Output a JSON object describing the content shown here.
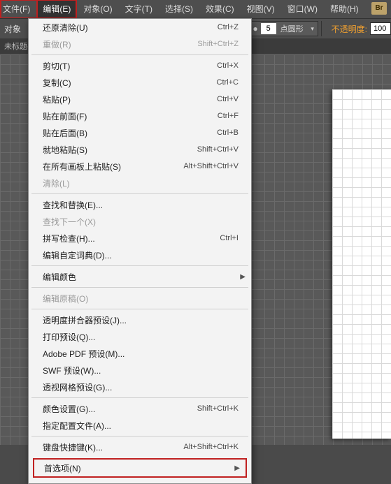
{
  "menubar": {
    "file": "文件(F)",
    "edit": "编辑(E)",
    "object": "对象(O)",
    "type": "文字(T)",
    "select": "选择(S)",
    "effect": "效果(C)",
    "view": "视图(V)",
    "window": "窗口(W)",
    "help": "帮助(H)",
    "br": "Br"
  },
  "optstrip": {
    "target": "对象",
    "stroke_pt": "5",
    "stroke_style": "点圆形",
    "opacity_label": "不透明度:",
    "opacity_value": "100"
  },
  "tab": {
    "title": "未标题-"
  },
  "menu": {
    "undo": {
      "label": "还原清除(U)",
      "sc": "Ctrl+Z"
    },
    "redo": {
      "label": "重做(R)",
      "sc": "Shift+Ctrl+Z"
    },
    "cut": {
      "label": "剪切(T)",
      "sc": "Ctrl+X"
    },
    "copy": {
      "label": "复制(C)",
      "sc": "Ctrl+C"
    },
    "paste": {
      "label": "粘贴(P)",
      "sc": "Ctrl+V"
    },
    "pasteFront": {
      "label": "贴在前面(F)",
      "sc": "Ctrl+F"
    },
    "pasteBack": {
      "label": "贴在后面(B)",
      "sc": "Ctrl+B"
    },
    "pasteInPlace": {
      "label": "就地粘贴(S)",
      "sc": "Shift+Ctrl+V"
    },
    "pasteAll": {
      "label": "在所有画板上粘贴(S)",
      "sc": "Alt+Shift+Ctrl+V"
    },
    "clear": {
      "label": "清除(L)",
      "sc": ""
    },
    "findReplace": {
      "label": "查找和替换(E)...",
      "sc": ""
    },
    "findNext": {
      "label": "查找下一个(X)",
      "sc": ""
    },
    "spell": {
      "label": "拼写检查(H)...",
      "sc": "Ctrl+I"
    },
    "dict": {
      "label": "编辑自定词典(D)...",
      "sc": ""
    },
    "editColors": {
      "label": "编辑颜色",
      "sc": ""
    },
    "editOrig": {
      "label": "编辑原稿(O)",
      "sc": ""
    },
    "transp": {
      "label": "透明度拼合器预设(J)...",
      "sc": ""
    },
    "print": {
      "label": "打印预设(Q)...",
      "sc": ""
    },
    "pdf": {
      "label": "Adobe PDF 预设(M)...",
      "sc": ""
    },
    "swf": {
      "label": "SWF 预设(W)...",
      "sc": ""
    },
    "persp": {
      "label": "透视网格预设(G)...",
      "sc": ""
    },
    "colorSet": {
      "label": "颜色设置(G)...",
      "sc": "Shift+Ctrl+K"
    },
    "assign": {
      "label": "指定配置文件(A)...",
      "sc": ""
    },
    "shortcuts": {
      "label": "键盘快捷键(K)...",
      "sc": "Alt+Shift+Ctrl+K"
    },
    "prefs": {
      "label": "首选项(N)",
      "sc": ""
    }
  }
}
